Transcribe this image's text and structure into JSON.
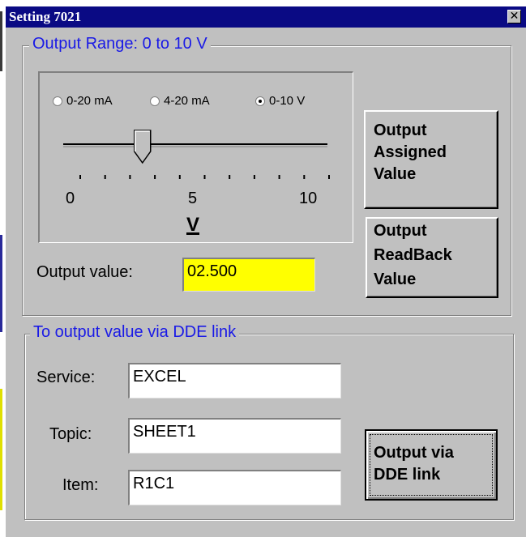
{
  "window": {
    "title": "Setting 7021",
    "close_glyph": "✕"
  },
  "output_range": {
    "legend": "Output Range: 0 to 10 V",
    "radios": [
      {
        "label": "0-20 mA",
        "checked": false
      },
      {
        "label": "4-20 mA",
        "checked": false
      },
      {
        "label": "0-10 V",
        "checked": true
      }
    ],
    "slider": {
      "min": 0,
      "max": 10,
      "value": 2.5
    },
    "scale_labels": [
      "0",
      "5",
      "10"
    ],
    "unit": "V",
    "output_value_label": "Output value:",
    "output_value": "02.500",
    "output_value_bg": "#ffff00",
    "assigned_button": "Output\nAssigned\nValue",
    "readback_button": "Output\nReadBack\nValue"
  },
  "dde": {
    "legend": "To output value via DDE link",
    "service_label": "Service:",
    "service_value": "EXCEL",
    "topic_label": "Topic:",
    "topic_value": "SHEET1",
    "item_label": "Item:",
    "item_value": "R1C1",
    "button": "Output via\nDDE link"
  },
  "colors": {
    "titlebar": "#0a0a84",
    "legend_text": "#1a1ae6",
    "face": "#c0c0c0"
  }
}
